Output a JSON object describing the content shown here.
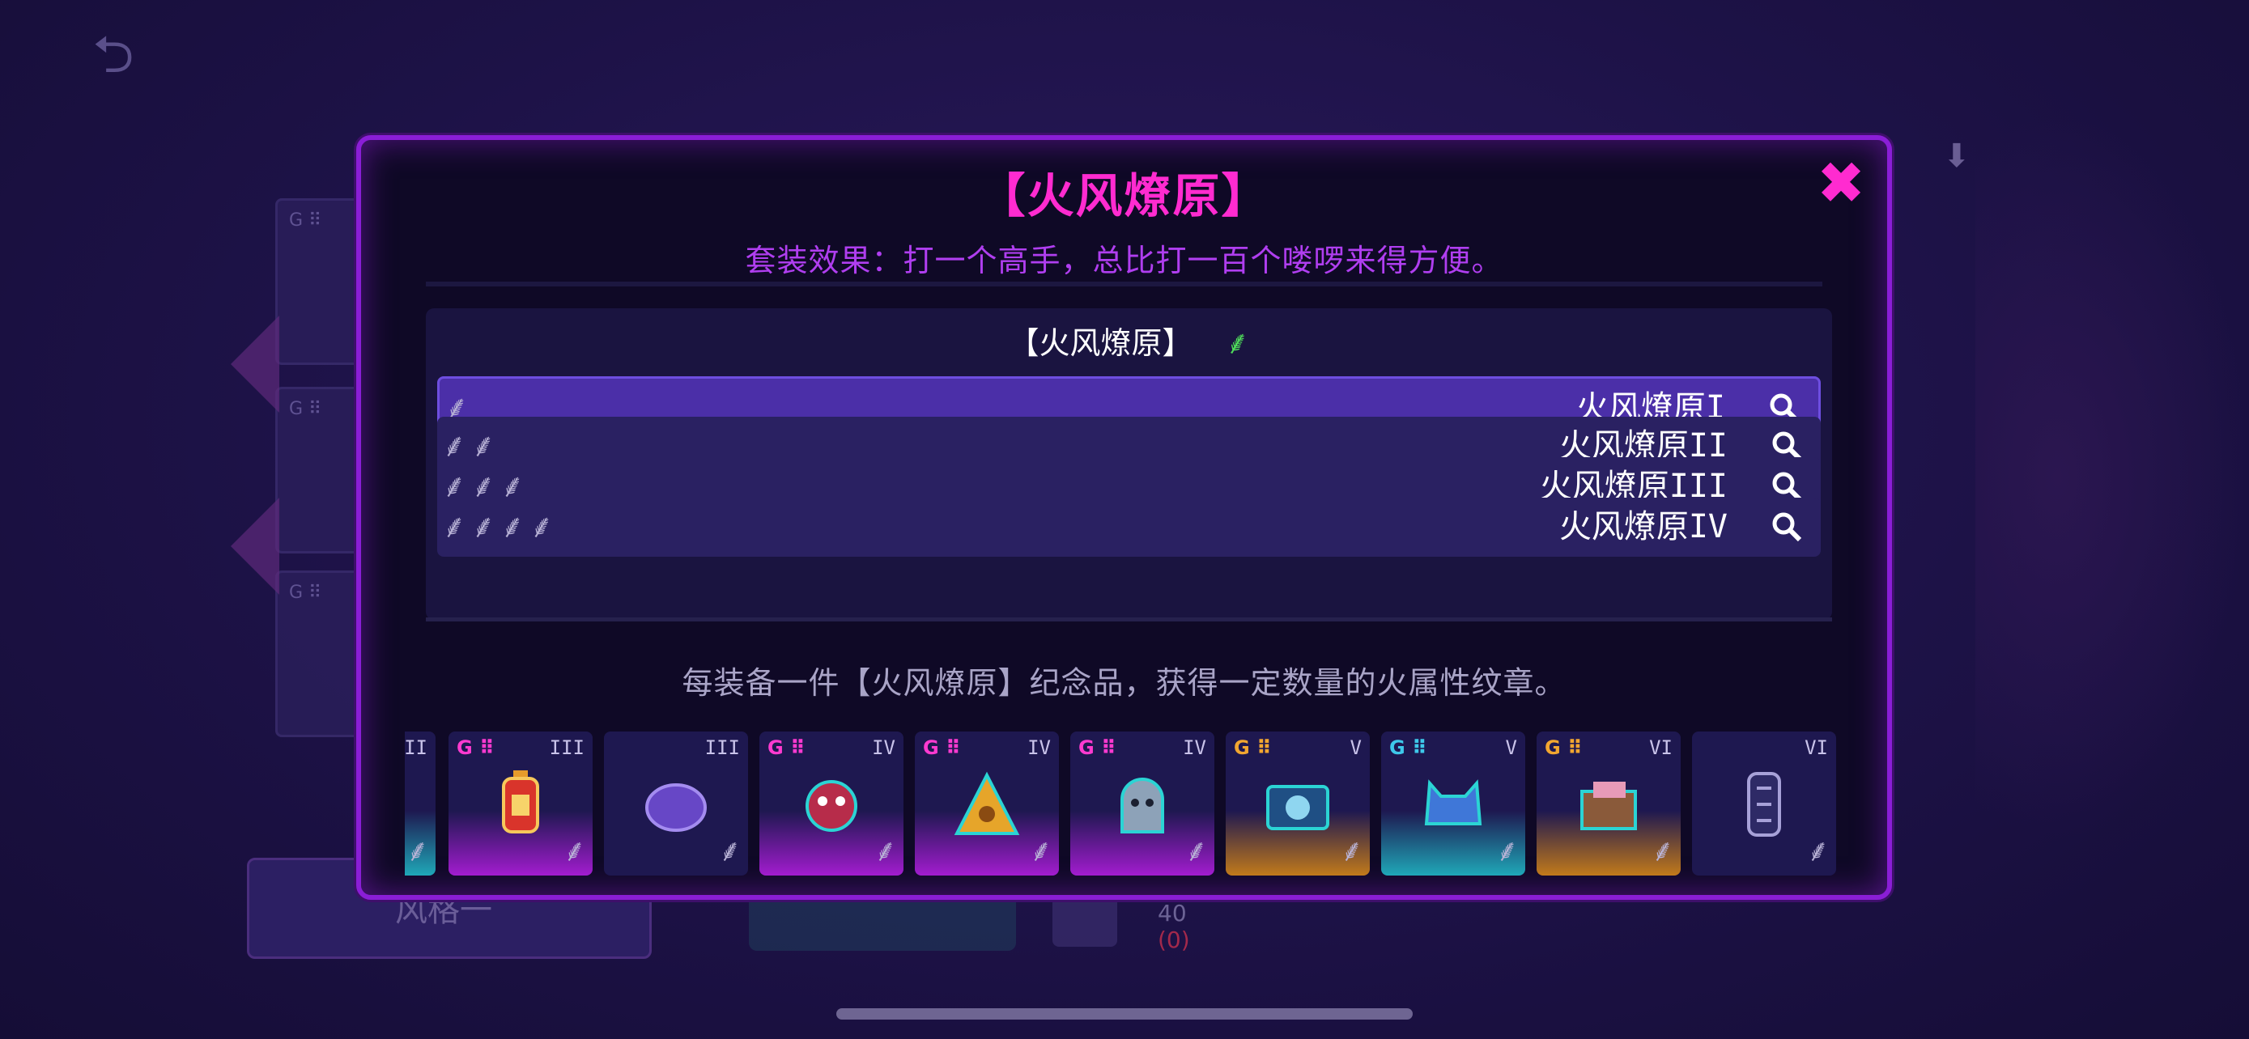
{
  "background": {
    "back_icon": "back-arrow-icon",
    "bottom_button_label": "风格一",
    "bottom_value_1": "40",
    "bottom_value_2": "(0)"
  },
  "modal": {
    "title": "【火风燎原】",
    "close_icon": "close-icon",
    "set_effect": "套装效果：打一个高手，总比打一百个喽啰来得方便。",
    "panel_header": "【火风燎原】",
    "tiers": [
      {
        "name": "火风燎原I",
        "count": 1,
        "active": true
      },
      {
        "name": "火风燎原II",
        "count": 2,
        "active": false
      },
      {
        "name": "火风燎原III",
        "count": 3,
        "active": false
      },
      {
        "name": "火风燎原IV",
        "count": 4,
        "active": false
      }
    ],
    "description": "每装备一件【火风燎原】纪念品，获得一定数量的火属性纹章。",
    "items": [
      {
        "tier": "II",
        "badge": "",
        "rarity": "cyan",
        "icon": "partial-item-icon"
      },
      {
        "tier": "III",
        "badge": "G",
        "rarity": "magenta",
        "icon": "lantern-icon"
      },
      {
        "tier": "III",
        "badge": "",
        "rarity": "none",
        "icon": "purple-shell-icon"
      },
      {
        "tier": "IV",
        "badge": "G",
        "rarity": "magenta",
        "icon": "red-frog-icon"
      },
      {
        "tier": "IV",
        "badge": "G",
        "rarity": "magenta",
        "icon": "money-bag-icon"
      },
      {
        "tier": "IV",
        "badge": "G",
        "rarity": "magenta",
        "icon": "ghost-icon"
      },
      {
        "tier": "V",
        "badge": "G",
        "rarity": "orange",
        "icon": "camera-icon"
      },
      {
        "tier": "V",
        "badge": "G",
        "rarity": "cyan",
        "icon": "blue-cat-icon"
      },
      {
        "tier": "VI",
        "badge": "G",
        "rarity": "orange",
        "icon": "gift-box-icon"
      },
      {
        "tier": "VI",
        "badge": "",
        "rarity": "none",
        "icon": "hourglass-icon"
      }
    ]
  },
  "colors": {
    "title": "#ff2bd0",
    "set_effect": "#b03ef0",
    "border": "#8a1ed6",
    "leaf_green": "#4fdc5a",
    "active_row": "#4b2fa8"
  }
}
